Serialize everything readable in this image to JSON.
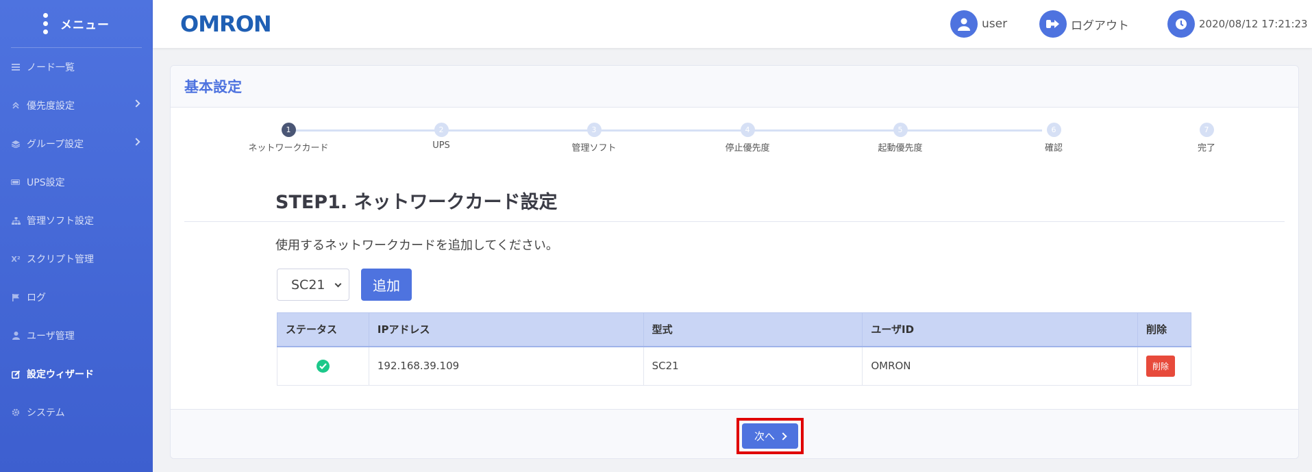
{
  "sidebar": {
    "title": "メニュー",
    "items": [
      {
        "label": "ノード一覧",
        "icon": "list-icon",
        "arrow": false,
        "active": false
      },
      {
        "label": "優先度設定",
        "icon": "sort-icon",
        "arrow": true,
        "active": false
      },
      {
        "label": "グループ設定",
        "icon": "layers-icon",
        "arrow": true,
        "active": false
      },
      {
        "label": "UPS設定",
        "icon": "battery-icon",
        "arrow": false,
        "active": false
      },
      {
        "label": "管理ソフト設定",
        "icon": "sitemap-icon",
        "arrow": false,
        "active": false
      },
      {
        "label": "スクリプト管理",
        "icon": "superscript-icon",
        "arrow": false,
        "active": false
      },
      {
        "label": "ログ",
        "icon": "flag-icon",
        "arrow": false,
        "active": false
      },
      {
        "label": "ユーザ管理",
        "icon": "user-icon",
        "arrow": false,
        "active": false
      },
      {
        "label": "設定ウィザード",
        "icon": "edit-icon",
        "arrow": false,
        "active": true
      },
      {
        "label": "システム",
        "icon": "gear-icon",
        "arrow": false,
        "active": false
      }
    ]
  },
  "header": {
    "logo": "OMRON",
    "user": "user",
    "logout": "ログアウト",
    "datetime": "2020/08/12 17:21:23"
  },
  "card": {
    "title": "基本設定",
    "steps": [
      {
        "num": "1",
        "label": "ネットワークカード",
        "current": true
      },
      {
        "num": "2",
        "label": "UPS",
        "current": false
      },
      {
        "num": "3",
        "label": "管理ソフト",
        "current": false
      },
      {
        "num": "4",
        "label": "停止優先度",
        "current": false
      },
      {
        "num": "5",
        "label": "起動優先度",
        "current": false
      },
      {
        "num": "6",
        "label": "確認",
        "current": false
      },
      {
        "num": "7",
        "label": "完了",
        "current": false
      }
    ],
    "step_title": "STEP1. ネットワークカード設定",
    "instruction": "使用するネットワークカードを追加してください。",
    "select_value": "SC21",
    "add_label": "追加",
    "table": {
      "headers": [
        "ステータス",
        "IPアドレス",
        "型式",
        "ユーザID",
        "削除"
      ],
      "rows": [
        {
          "status": "ok",
          "ip": "192.168.39.109",
          "model": "SC21",
          "user_id": "OMRON",
          "delete_label": "削除"
        }
      ]
    },
    "next_label": "次へ"
  },
  "colors": {
    "primary": "#4e73df",
    "success": "#1cc88a",
    "danger": "#e74a3b",
    "highlight": "#e00000"
  }
}
